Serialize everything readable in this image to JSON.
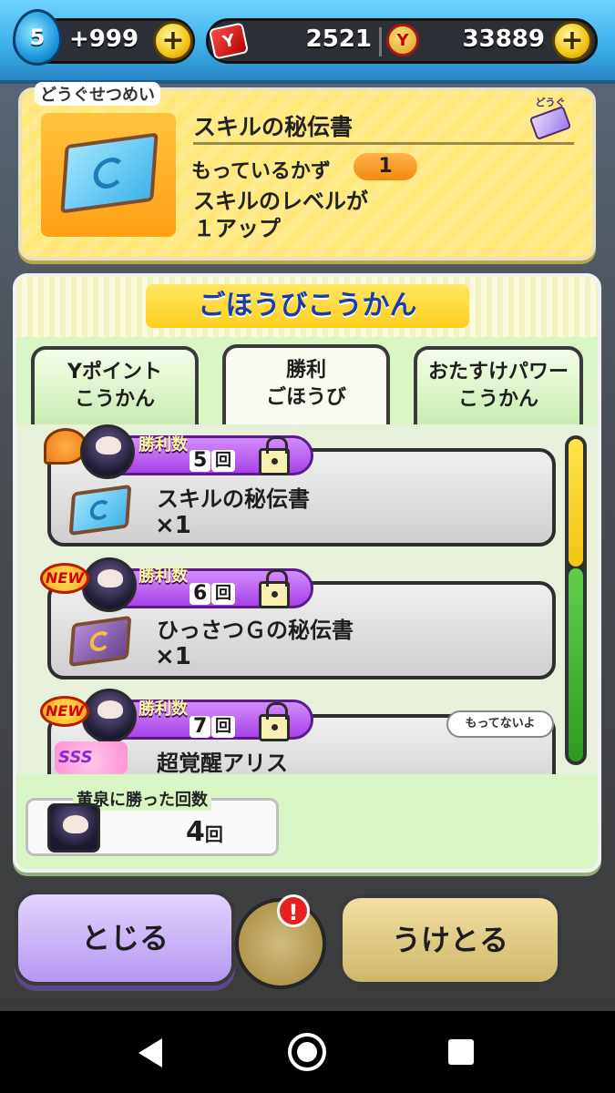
{
  "status_bar": {
    "level": "5",
    "stamina": "+999",
    "ymoney": "2521",
    "ycoin": "33889"
  },
  "item_detail": {
    "section_label": "どうぐせつめい",
    "category_tag": "どうぐ",
    "name": "スキルの秘伝書",
    "owned_label": "もっているかず",
    "owned_count": "1",
    "description_line1": "スキルのレベルが",
    "description_line2": "１アップ"
  },
  "reward_panel": {
    "title": "ごほうびこうかん",
    "tabs": [
      {
        "line1": "Yポイント",
        "line2": "こうかん",
        "active": false
      },
      {
        "line1": "勝利",
        "line2": "ごほうび",
        "active": true
      },
      {
        "line1": "おたすけパワー",
        "line2": "こうかん",
        "active": false
      }
    ],
    "rewards": [
      {
        "wins_label": "勝利数",
        "wins_count": "5",
        "wins_unit": "回",
        "item": "スキルの秘伝書",
        "qty": "×1",
        "badge": "flag"
      },
      {
        "wins_label": "勝利数",
        "wins_count": "6",
        "wins_unit": "回",
        "badge_text": "NEW",
        "item": "ひっさつＧの秘伝書",
        "qty": "×1",
        "badge": "new"
      },
      {
        "wins_label": "勝利数",
        "wins_count": "7",
        "wins_unit": "回",
        "badge_text": "NEW",
        "item": "超覚醒アリス",
        "tooltip": "もってないよ",
        "rank": "SSS",
        "badge": "new"
      }
    ],
    "win_count_label": "黄泉に勝った回数",
    "win_count_value": "4",
    "win_count_unit": "回"
  },
  "buttons": {
    "close": "とじる",
    "receive": "うけとる"
  },
  "colors": {
    "accent_blue": "#1a3ea8",
    "win_badge_purple": "#a842e6",
    "scroll_yellow": "#f3c214",
    "scroll_green": "#2e9a24"
  }
}
